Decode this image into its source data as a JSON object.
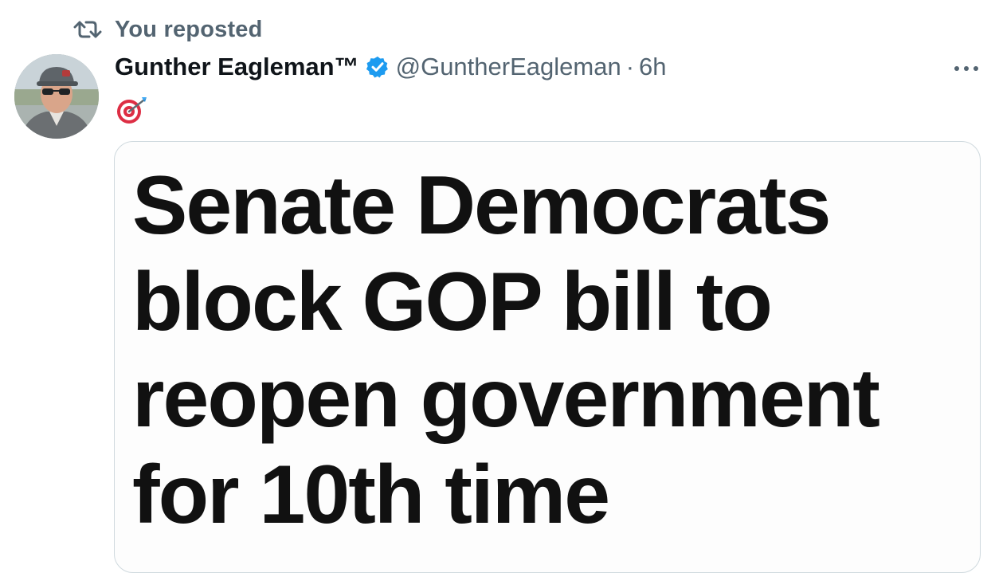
{
  "repost": {
    "icon": "repost-icon",
    "label": "You reposted"
  },
  "author": {
    "avatar": "avatar",
    "display_name": "Gunther Eagleman™",
    "verified_icon": "verified-badge-icon",
    "verified_color": "#1d9bf0",
    "handle": "@GuntherEagleman",
    "separator": "·",
    "time": "6h"
  },
  "tweet": {
    "text_emoji": "🎯",
    "more_icon": "more-options-icon"
  },
  "media": {
    "headline": "Senate Democrats\nblock GOP bill to\nreopen government\nfor 10th time"
  },
  "colors": {
    "secondary_text": "#536471",
    "primary_text": "#0f1419",
    "card_border": "#cfd9de"
  }
}
